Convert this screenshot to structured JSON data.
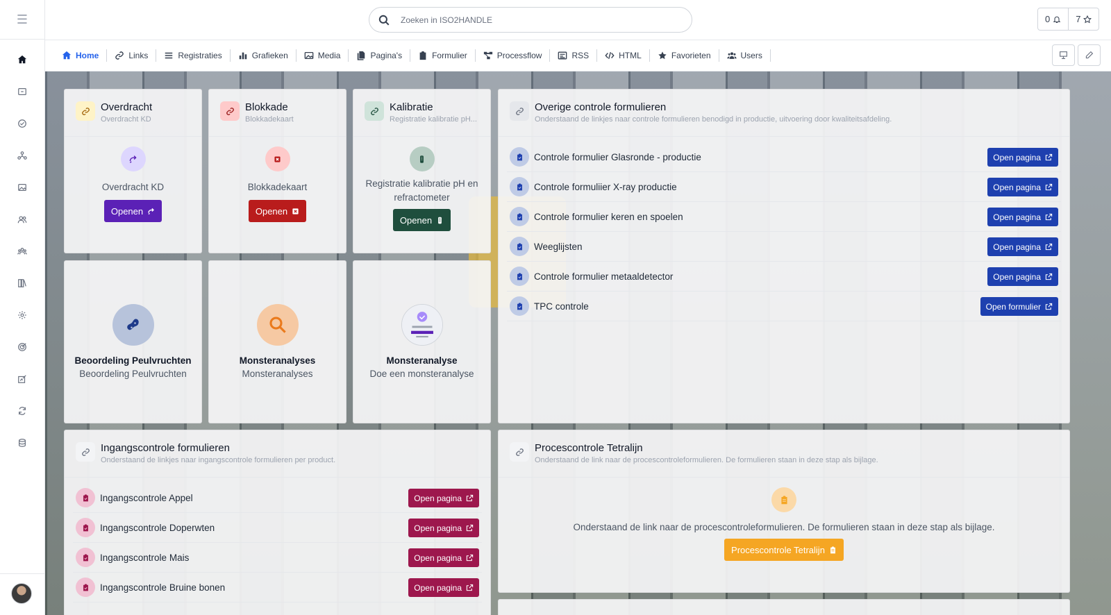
{
  "topbar": {
    "search_placeholder": "Zoeken in ISO2HANDLE",
    "notifications_count": "0",
    "favorites_count": "7"
  },
  "sidebar": {
    "icons": [
      "home-icon",
      "folder-icon",
      "check-circle-icon",
      "network-icon",
      "images-icon",
      "users-icon",
      "group-icon",
      "books-icon",
      "gear-icon",
      "target-icon",
      "edit-chart-icon",
      "refresh-icon",
      "database-icon"
    ]
  },
  "nav": {
    "items": [
      {
        "label": "Home",
        "icon": "home-icon"
      },
      {
        "label": "Links",
        "icon": "link-icon"
      },
      {
        "label": "Registraties",
        "icon": "list-icon"
      },
      {
        "label": "Grafieken",
        "icon": "bar-chart-icon"
      },
      {
        "label": "Media",
        "icon": "images-icon"
      },
      {
        "label": "Pagina's",
        "icon": "pages-icon"
      },
      {
        "label": "Formulier",
        "icon": "clipboard-icon"
      },
      {
        "label": "Processflow",
        "icon": "flow-icon"
      },
      {
        "label": "RSS",
        "icon": "rss-icon"
      },
      {
        "label": "HTML",
        "icon": "code-icon"
      },
      {
        "label": "Favorieten",
        "icon": "star-icon"
      },
      {
        "label": "Users",
        "icon": "users-icon"
      }
    ]
  },
  "cards": {
    "overdracht": {
      "title": "Overdracht",
      "subtitle": "Overdracht KD",
      "text": "Overdracht KD",
      "button": "Openen",
      "color": "#5b21b6"
    },
    "blokkade": {
      "title": "Blokkade",
      "subtitle": "Blokkadekaart",
      "text": "Blokkadekaart",
      "button": "Openen",
      "color": "#b91c1c"
    },
    "kalibratie": {
      "title": "Kalibratie",
      "subtitle": "Registratie kalibratie pH...",
      "text_line1": "Registratie kalibratie pH en",
      "text_line2": "refractometer",
      "button": "Openen",
      "color": "#1f4e3d"
    },
    "beoordeling": {
      "title": "Beoordeling Peulvruchten",
      "subtitle": "Beoordeling Peulvruchten"
    },
    "monsteranalyses": {
      "title": "Monsteranalyses",
      "subtitle": "Monsteranalyses"
    },
    "monsteranalyse": {
      "title": "Monsteranalyse",
      "subtitle": "Doe een monsteranalyse"
    }
  },
  "overige": {
    "title": "Overige controle formulieren",
    "subtitle": "Onderstaand de linkjes naar controle formulieren benodigd in productie, uitvoering door kwaliteitsafdeling.",
    "rows": [
      {
        "label": "Controle formulier Glasronde - productie",
        "button": "Open pagina"
      },
      {
        "label": "Controle formuliier X-ray productie",
        "button": "Open pagina"
      },
      {
        "label": "Controle formulier keren en spoelen",
        "button": "Open pagina"
      },
      {
        "label": "Weeglijsten",
        "button": "Open pagina"
      },
      {
        "label": "Controle formulier metaaldetector",
        "button": "Open pagina"
      },
      {
        "label": "TPC controle",
        "button": "Open formulier"
      }
    ]
  },
  "ingang": {
    "title": "Ingangscontrole formulieren",
    "subtitle": "Onderstaand de linkjes naar ingangscontrole formulieren per product.",
    "rows": [
      {
        "label": "Ingangscontrole Appel",
        "button": "Open pagina"
      },
      {
        "label": "Ingangscontrole Doperwten",
        "button": "Open pagina"
      },
      {
        "label": "Ingangscontrole Mais",
        "button": "Open pagina"
      },
      {
        "label": "Ingangscontrole Bruine bonen",
        "button": "Open pagina"
      }
    ]
  },
  "proces": {
    "title": "Procescontrole Tetralijn",
    "subtitle": "Onderstaand de link naar de procescontroleformulieren. De formulieren staan in deze stap als bijlage.",
    "body": "Onderstaand de link naar de procescontroleformulieren. De formulieren staan in deze stap als bijlage.",
    "button": "Procescontrole Tetralijn",
    "color": "#f5a623"
  }
}
